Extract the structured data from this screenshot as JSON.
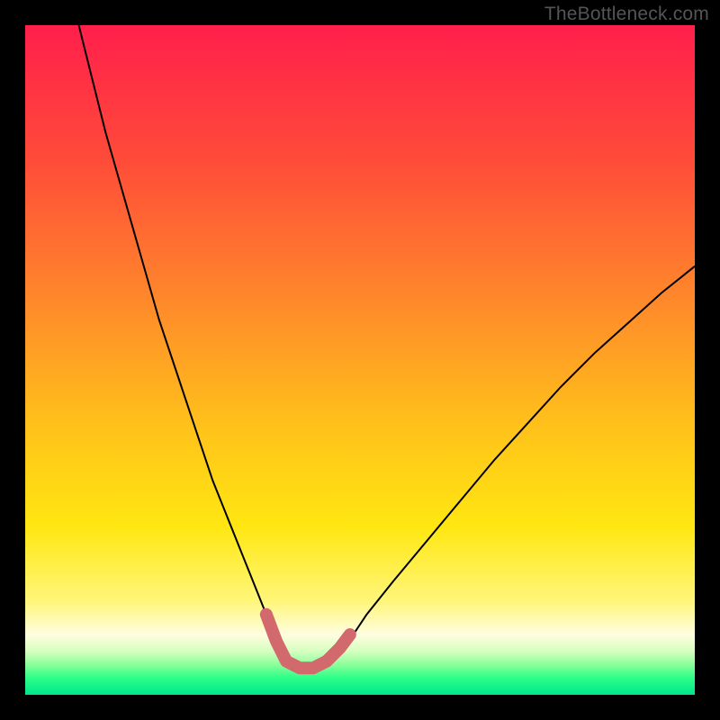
{
  "watermark": {
    "text": "TheBottleneck.com"
  },
  "chart_data": {
    "type": "line",
    "title": "",
    "xlabel": "",
    "ylabel": "",
    "xlim": [
      0,
      100
    ],
    "ylim": [
      0,
      100
    ],
    "grid": false,
    "legend": false,
    "background_gradient_stops": [
      {
        "offset": 0.0,
        "color": "#ff1f4b"
      },
      {
        "offset": 0.2,
        "color": "#ff4b39"
      },
      {
        "offset": 0.42,
        "color": "#ff8b2a"
      },
      {
        "offset": 0.6,
        "color": "#ffc21a"
      },
      {
        "offset": 0.75,
        "color": "#ffe712"
      },
      {
        "offset": 0.86,
        "color": "#fff67a"
      },
      {
        "offset": 0.91,
        "color": "#fffde0"
      },
      {
        "offset": 0.935,
        "color": "#d6ffc0"
      },
      {
        "offset": 0.955,
        "color": "#8aff9a"
      },
      {
        "offset": 0.975,
        "color": "#2bff87"
      },
      {
        "offset": 1.0,
        "color": "#00e58c"
      }
    ],
    "series": [
      {
        "name": "bottleneck-curve",
        "color": "#000000",
        "width": 2,
        "x": [
          8,
          10,
          12,
          14,
          16,
          18,
          20,
          22,
          24,
          26,
          28,
          30,
          32,
          34,
          36,
          37.5,
          39,
          41,
          43,
          45,
          47,
          49,
          51,
          55,
          60,
          65,
          70,
          75,
          80,
          85,
          90,
          95,
          100
        ],
        "values": [
          100,
          92,
          84,
          77,
          70,
          63,
          56,
          50,
          44,
          38,
          32,
          27,
          22,
          17,
          12,
          8,
          5,
          4,
          4,
          5,
          7,
          9,
          12,
          17,
          23,
          29,
          35,
          40.5,
          46,
          51,
          55.5,
          60,
          64
        ]
      },
      {
        "name": "highlight-segment",
        "color": "#d1696d",
        "width": 14,
        "linecap": "round",
        "x": [
          36,
          37.5,
          39,
          41,
          43,
          45,
          47,
          48.5
        ],
        "values": [
          12,
          8,
          5,
          4,
          4,
          5,
          7,
          9
        ]
      }
    ]
  }
}
